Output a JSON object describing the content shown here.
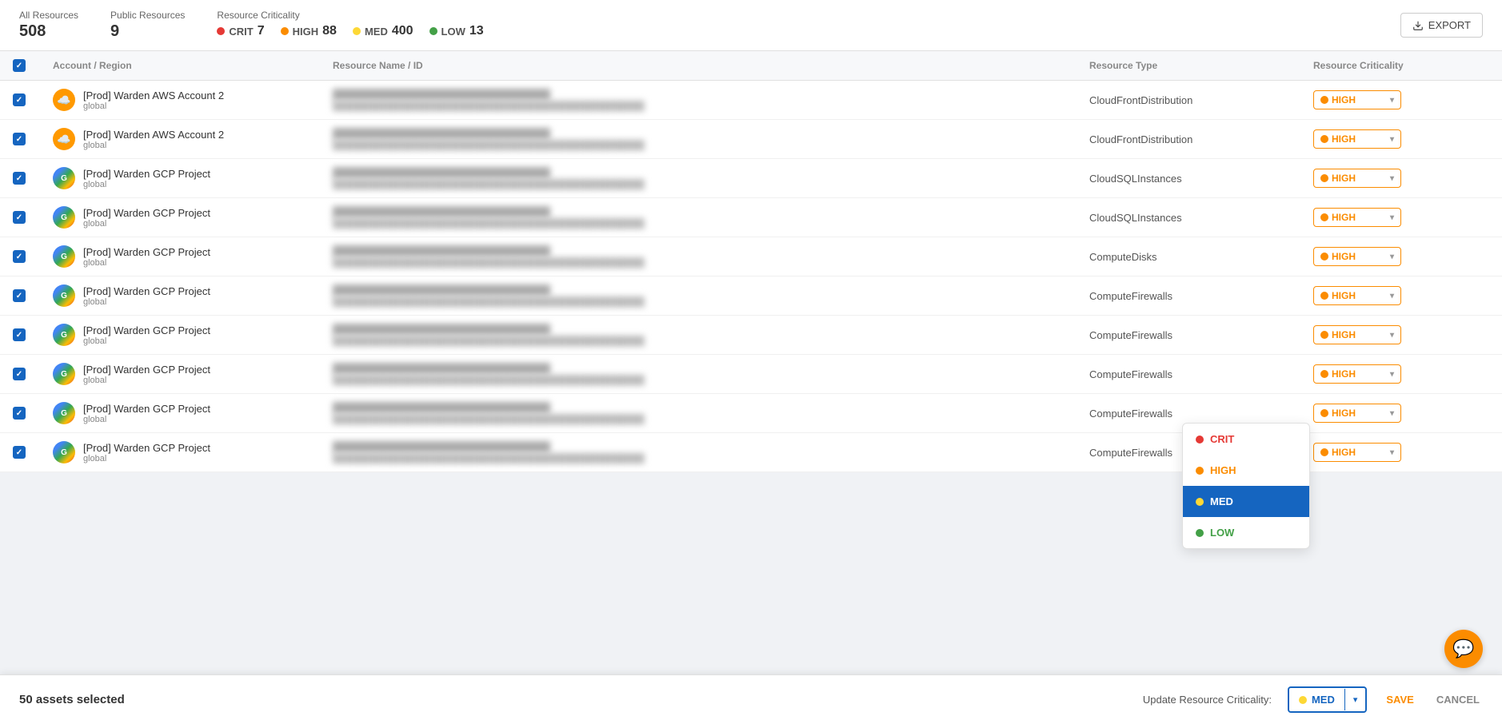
{
  "header": {
    "all_resources_label": "All Resources",
    "all_resources_count": "508",
    "public_resources_label": "Public Resources",
    "public_resources_count": "9",
    "criticality_label": "Resource Criticality",
    "crit_label": "CRIT",
    "crit_count": "7",
    "high_label": "HIGH",
    "high_count": "88",
    "med_label": "MED",
    "med_count": "400",
    "low_label": "LOW",
    "low_count": "13",
    "export_label": "EXPORT"
  },
  "table": {
    "headers": {
      "account": "Account / Region",
      "resource": "Resource Name / ID",
      "type": "Resource Type",
      "criticality": "Resource Criticality"
    },
    "rows": [
      {
        "account": "[Prod] Warden AWS Account 2",
        "region": "global",
        "type_icon": "aws",
        "resource_type": "CloudFrontDistribution",
        "criticality": "HIGH"
      },
      {
        "account": "[Prod] Warden AWS Account 2",
        "region": "global",
        "type_icon": "aws",
        "resource_type": "CloudFrontDistribution",
        "criticality": "HIGH"
      },
      {
        "account": "[Prod] Warden GCP Project",
        "region": "global",
        "type_icon": "gcp",
        "resource_type": "CloudSQLInstances",
        "criticality": "HIGH"
      },
      {
        "account": "[Prod] Warden GCP Project",
        "region": "global",
        "type_icon": "gcp",
        "resource_type": "CloudSQLInstances",
        "criticality": "HIGH"
      },
      {
        "account": "[Prod] Warden GCP Project",
        "region": "global",
        "type_icon": "gcp",
        "resource_type": "ComputeDisks",
        "criticality": "HIGH"
      },
      {
        "account": "[Prod] Warden GCP Project",
        "region": "global",
        "type_icon": "gcp",
        "resource_type": "ComputeFirewalls",
        "criticality": "HIGH"
      },
      {
        "account": "[Prod] Warden GCP Project",
        "region": "global",
        "type_icon": "gcp",
        "resource_type": "ComputeFirewalls",
        "criticality": "HIGH"
      },
      {
        "account": "[Prod] Warden GCP Project",
        "region": "global",
        "type_icon": "gcp",
        "resource_type": "ComputeFirewalls",
        "criticality": "HIGH"
      },
      {
        "account": "[Prod] Warden GCP Project",
        "region": "global",
        "type_icon": "gcp",
        "resource_type": "ComputeFirewalls",
        "criticality": "HIGH"
      },
      {
        "account": "[Prod] Warden GCP Project",
        "region": "global",
        "type_icon": "gcp",
        "resource_type": "ComputeFirewalls",
        "criticality": "HIGH"
      }
    ]
  },
  "dropdown": {
    "items": [
      {
        "label": "CRIT",
        "color": "crit"
      },
      {
        "label": "HIGH",
        "color": "high"
      },
      {
        "label": "MED",
        "color": "med",
        "selected": true
      },
      {
        "label": "LOW",
        "color": "low"
      }
    ]
  },
  "bottom_bar": {
    "selected_text": "50 assets selected",
    "update_label": "Update Resource Criticality:",
    "selected_value": "MED",
    "save_label": "SAVE",
    "cancel_label": "CANCEL"
  },
  "chat_icon": "💬"
}
